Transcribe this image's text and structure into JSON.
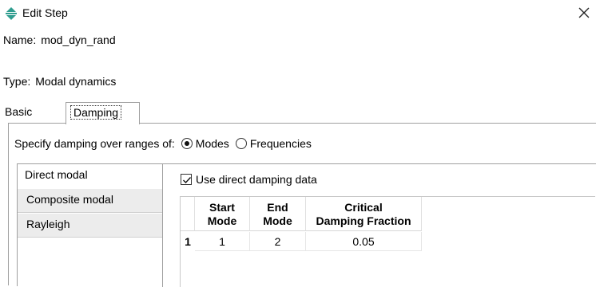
{
  "window": {
    "title": "Edit Step",
    "close_label": "×"
  },
  "step": {
    "name_label": "Name:",
    "name_value": "mod_dyn_rand",
    "type_label": "Type:",
    "type_value": "Modal dynamics"
  },
  "tabs": [
    {
      "label": "Basic",
      "active": false
    },
    {
      "label": "Damping",
      "active": true
    }
  ],
  "damping": {
    "specify_label": "Specify damping over ranges of:",
    "options": [
      {
        "label": "Modes",
        "selected": true
      },
      {
        "label": "Frequencies",
        "selected": false
      }
    ],
    "side_tabs": [
      {
        "label": "Direct modal",
        "active": true
      },
      {
        "label": "Composite modal",
        "active": false
      },
      {
        "label": "Rayleigh",
        "active": false
      }
    ],
    "use_direct_label": "Use direct damping data",
    "use_direct_checked": true,
    "table": {
      "headers": [
        {
          "line1": "Start",
          "line2": "Mode"
        },
        {
          "line1": "End",
          "line2": "Mode"
        },
        {
          "line1": "Critical",
          "line2": "Damping Fraction"
        }
      ],
      "rows": [
        {
          "index": "1",
          "start": "1",
          "end": "2",
          "fraction": "0.05"
        }
      ]
    }
  },
  "colors": {
    "icon_teal": "#2f9d8f",
    "border": "#a0a0a0",
    "inactive_tab_bg": "#ececec"
  },
  "icons": {
    "title": "move-arrows-icon",
    "close": "close-icon"
  }
}
